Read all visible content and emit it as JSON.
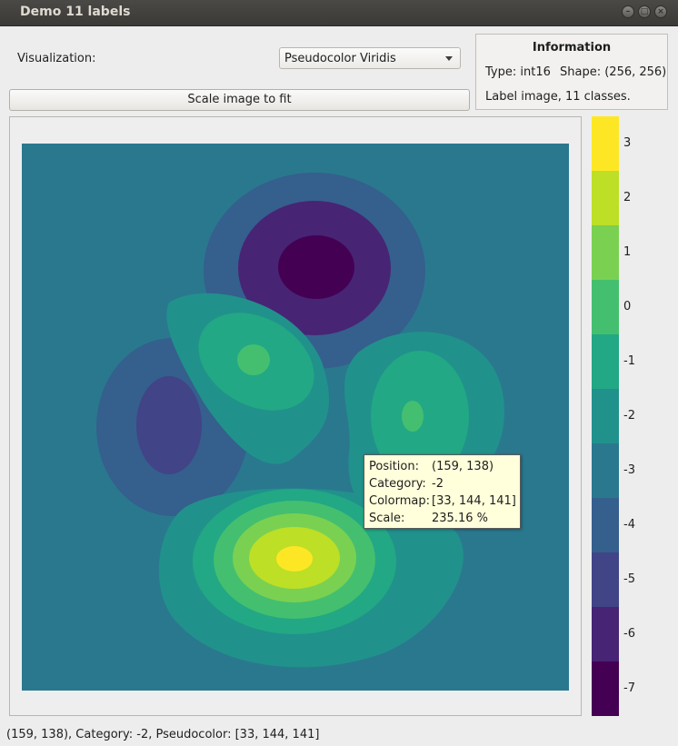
{
  "window": {
    "title": "Demo 11 labels"
  },
  "controls": {
    "visualization_label": "Visualization:",
    "visualization_value": "Pseudocolor Viridis",
    "scale_button": "Scale image to fit"
  },
  "info": {
    "heading": "Information",
    "type_text": "Type: int16",
    "shape_text": "Shape: (256, 256)",
    "description": "Label image, 11 classes."
  },
  "colorbar": {
    "labels": [
      "3",
      "2",
      "1",
      "0",
      "-1",
      "-2",
      "-3",
      "-4",
      "-5",
      "-6",
      "-7"
    ],
    "colors": [
      "#fde725",
      "#bddf26",
      "#7ad151",
      "#44bf70",
      "#22a884",
      "#21918c",
      "#2a788e",
      "#355f8d",
      "#414487",
      "#482475",
      "#440154"
    ]
  },
  "tooltip": {
    "position_key": "Position:",
    "position_val": "(159, 138)",
    "category_key": "Category:",
    "category_val": "-2",
    "colormap_key": "Colormap:",
    "colormap_val": "[33, 144, 141]",
    "scale_key": "Scale:",
    "scale_val": "235.16 %"
  },
  "status": {
    "text": "(159, 138), Category: -2, Pseudocolor: [33, 144, 141]"
  }
}
